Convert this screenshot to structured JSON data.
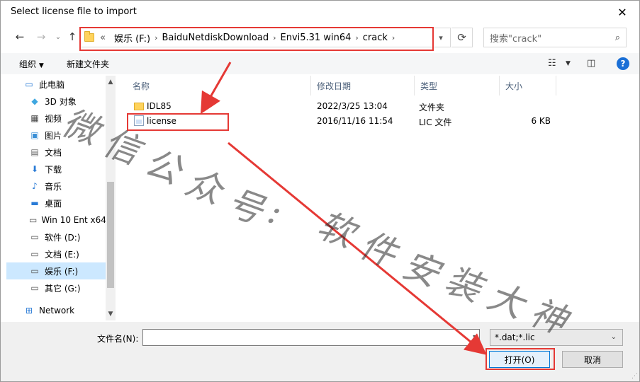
{
  "dialog": {
    "title": "Select license file to import"
  },
  "nav": {
    "crumbs": [
      "«",
      "娱乐 (F:)",
      "BaiduNetdiskDownload",
      "Envi5.31 win64",
      "crack"
    ],
    "search_placeholder": "搜索\"crack\""
  },
  "toolbar": {
    "organize": "组织",
    "new_folder": "新建文件夹"
  },
  "sidebar": {
    "items": [
      {
        "label": "此电脑",
        "icon": "computer-icon"
      },
      {
        "label": "3D 对象",
        "icon": "cube-icon"
      },
      {
        "label": "视频",
        "icon": "video-icon"
      },
      {
        "label": "图片",
        "icon": "picture-icon"
      },
      {
        "label": "文档",
        "icon": "document-icon"
      },
      {
        "label": "下载",
        "icon": "download-icon"
      },
      {
        "label": "音乐",
        "icon": "music-icon"
      },
      {
        "label": "桌面",
        "icon": "desktop-icon"
      },
      {
        "label": "Win 10 Ent x64",
        "icon": "drive-icon"
      },
      {
        "label": "软件 (D:)",
        "icon": "drive-icon"
      },
      {
        "label": "文档 (E:)",
        "icon": "drive-icon"
      },
      {
        "label": "娱乐 (F:)",
        "icon": "drive-icon"
      },
      {
        "label": "其它 (G:)",
        "icon": "drive-icon"
      },
      {
        "label": "Network",
        "icon": "network-icon"
      }
    ]
  },
  "columns": {
    "name": "名称",
    "date": "修改日期",
    "type": "类型",
    "size": "大小"
  },
  "files": [
    {
      "name": "IDL85",
      "date": "2022/3/25 13:04",
      "type": "文件夹",
      "size": ""
    },
    {
      "name": "license",
      "date": "2016/11/16 11:54",
      "type": "LIC 文件",
      "size": "6 KB"
    }
  ],
  "footer": {
    "filename_label": "文件名(N):",
    "filename_value": "",
    "filetype": "*.dat;*.lic",
    "open": "打开(O)",
    "cancel": "取消"
  },
  "watermark": [
    "微",
    "信",
    "公",
    "众",
    "号",
    ":",
    "软",
    "件",
    "安",
    "装",
    "大",
    "神"
  ],
  "colors": {
    "annotation": "#e53935",
    "selection": "#cce8ff",
    "accent": "#0078d7"
  }
}
